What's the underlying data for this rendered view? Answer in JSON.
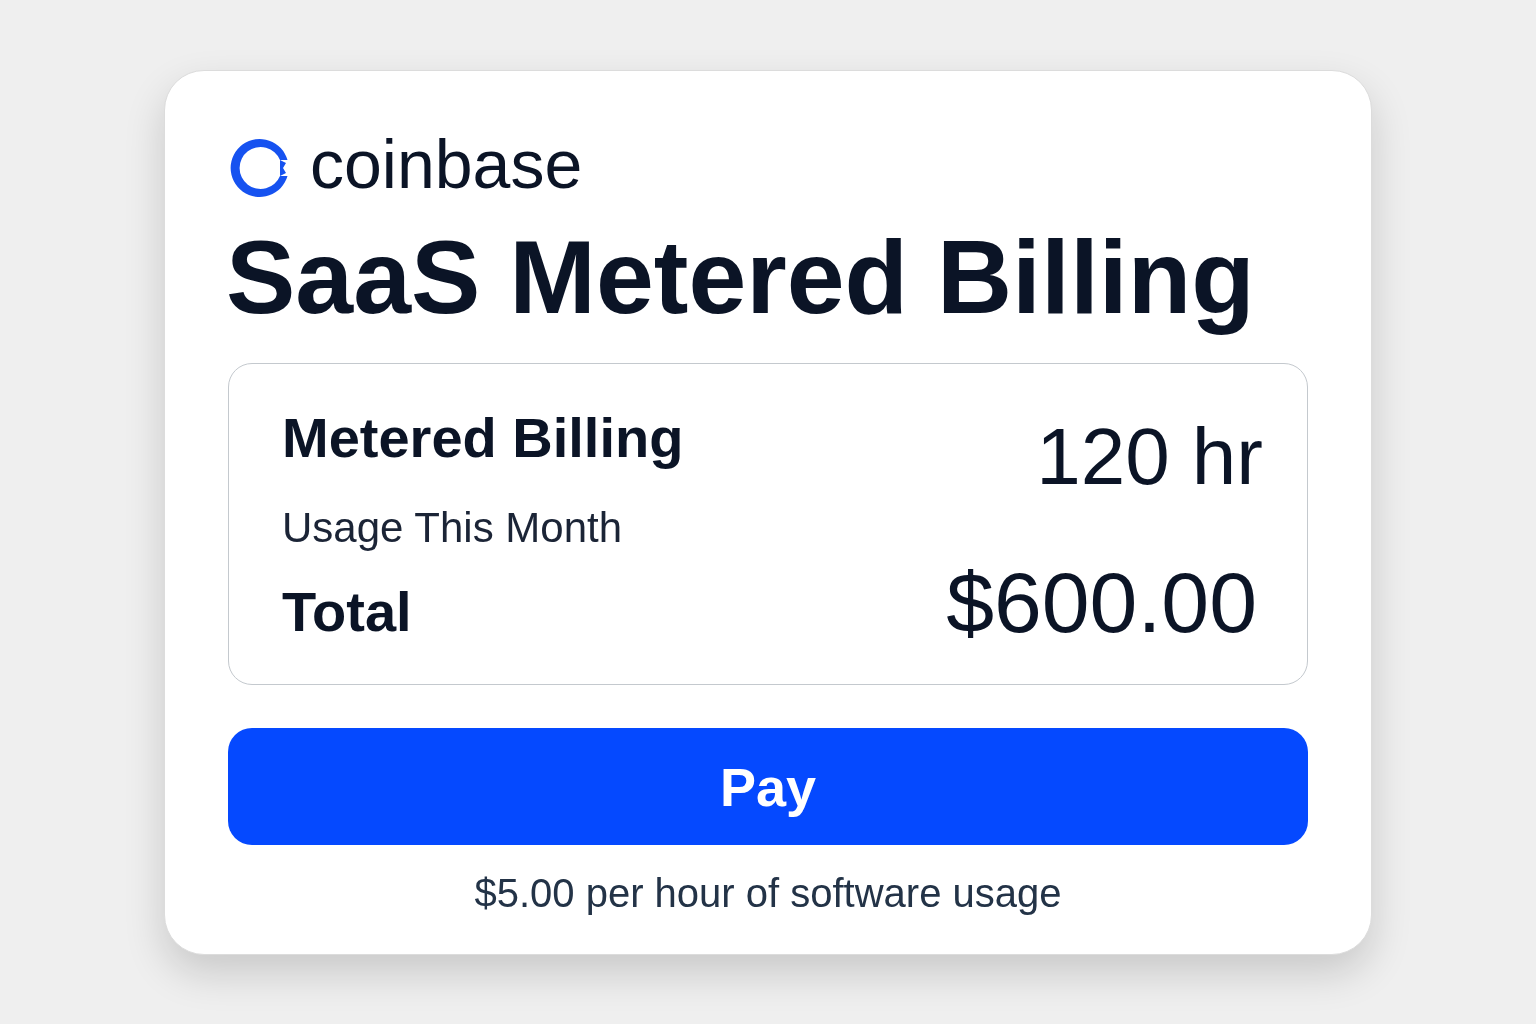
{
  "brand": {
    "name": "coinbase"
  },
  "title": "SaaS Metered Billing",
  "summary": {
    "item_label": "Metered Billing",
    "item_caption": "Usage This Month",
    "usage": "120 hr",
    "total_label": "Total",
    "total": "$600.00"
  },
  "pay_button": "Pay",
  "rate_note": "$5.00 per hour of software usage"
}
